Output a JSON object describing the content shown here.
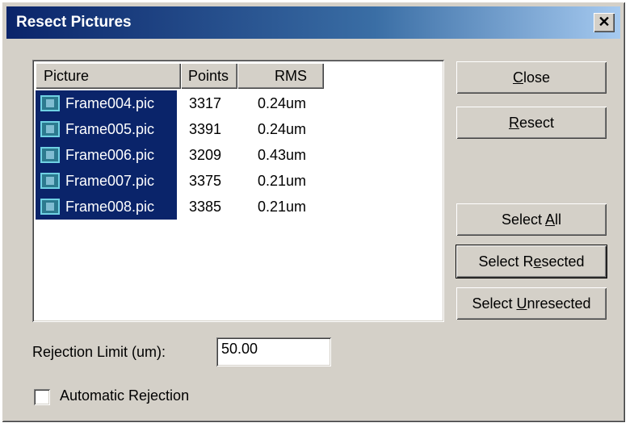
{
  "window": {
    "title": "Resect Pictures",
    "close_glyph": "✕"
  },
  "list": {
    "headers": {
      "picture": "Picture",
      "points": "Points",
      "rms": "RMS"
    },
    "rows": [
      {
        "name": "Frame004.pic",
        "points": "3317",
        "rms": "0.24um"
      },
      {
        "name": "Frame005.pic",
        "points": "3391",
        "rms": "0.24um"
      },
      {
        "name": "Frame006.pic",
        "points": "3209",
        "rms": "0.43um"
      },
      {
        "name": "Frame007.pic",
        "points": "3375",
        "rms": "0.21um"
      },
      {
        "name": "Frame008.pic",
        "points": "3385",
        "rms": "0.21um"
      }
    ]
  },
  "buttons": {
    "close": {
      "mnemonic": "C",
      "rest": "lose"
    },
    "resect": {
      "mnemonic": "R",
      "rest": "esect"
    },
    "select_all": {
      "pre": "Select ",
      "mnemonic": "A",
      "rest": "ll"
    },
    "select_resected": {
      "pre": "Select R",
      "mnemonic": "e",
      "rest": "sected"
    },
    "select_unresected": {
      "pre": "Select ",
      "mnemonic": "U",
      "rest": "nresected"
    }
  },
  "rejection": {
    "label": "Rejection Limit (um):",
    "value": "50.00"
  },
  "auto_rejection": {
    "label": "Automatic Rejection",
    "checked": false
  },
  "colors": {
    "title_bar": "#0a246a",
    "selection": "#0a246a",
    "face": "#d4d0c8"
  },
  "icons": {
    "row_icon": "picture-icon",
    "close_icon": "close-icon"
  }
}
